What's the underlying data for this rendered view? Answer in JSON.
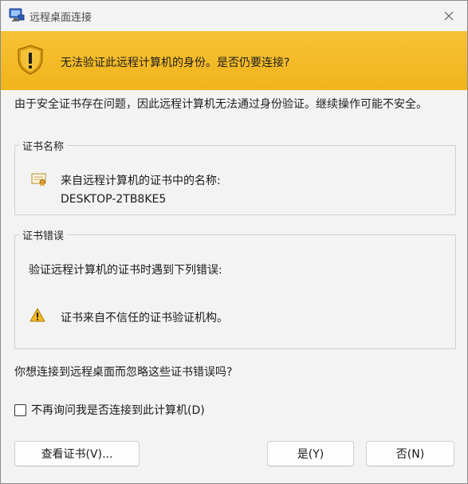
{
  "window": {
    "title": "远程桌面连接"
  },
  "banner": {
    "message": "无法验证此远程计算机的身份。是否仍要连接?"
  },
  "intro": {
    "text": "由于安全证书存在问题，因此远程计算机无法通过身份验证。继续操作可能不安全。"
  },
  "cert_name_group": {
    "legend": "证书名称",
    "label": "来自远程计算机的证书中的名称:",
    "value": "DESKTOP-2TB8KE5"
  },
  "cert_error_group": {
    "legend": "证书错误",
    "intro": "验证远程计算机的证书时遇到下列错误:",
    "errors": [
      "证书来自不信任的证书验证机构。"
    ]
  },
  "question": "你想连接到远程桌面而忽略这些证书错误吗?",
  "dont_ask": {
    "label": "不再询问我是否连接到此计算机(D)",
    "checked": false
  },
  "buttons": {
    "view_cert": "查看证书(V)...",
    "yes": "是(Y)",
    "no": "否(N)"
  },
  "colors": {
    "banner": "#f2b61c",
    "background": "#f3f3f3",
    "warning": "#f5b921"
  }
}
